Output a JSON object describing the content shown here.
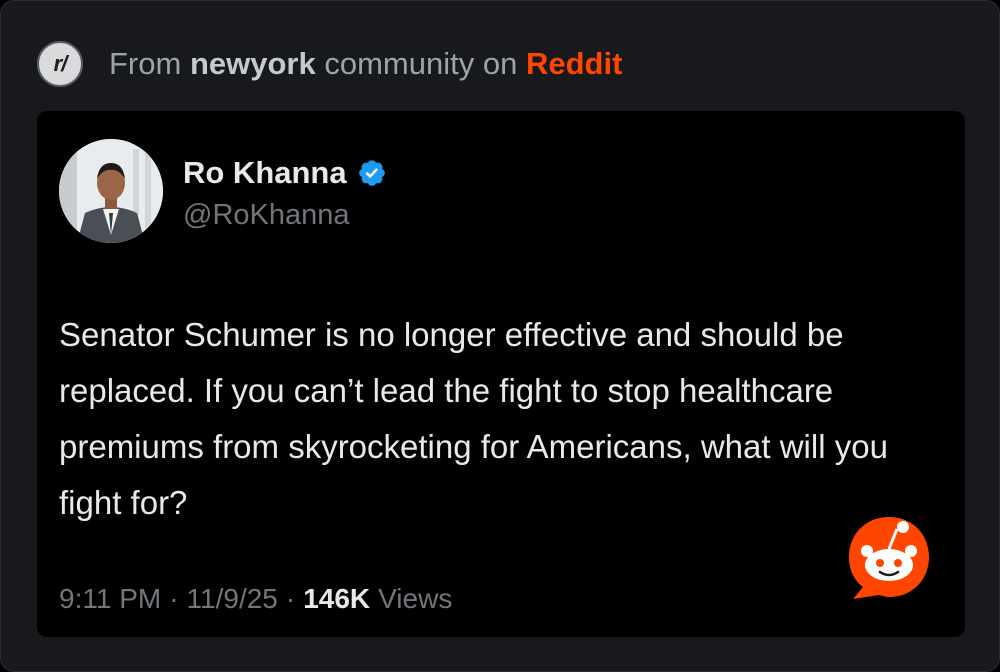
{
  "source": {
    "icon_text": "r/",
    "prefix": "From",
    "community": "newyork",
    "middle": "community on",
    "platform": "Reddit"
  },
  "tweet": {
    "author_name": "Ro Khanna",
    "handle": "@RoKhanna",
    "text": "Senator Schumer is no longer effective and should be replaced. If you can’t lead the fight to stop healthcare premiums from skyrocketing for Americans, what will you fight for?",
    "time": "9:11 PM",
    "date": "11/9/25",
    "views_count": "146K",
    "views_label": "Views",
    "separator": "·"
  },
  "colors": {
    "reddit_orange": "#ff4500",
    "verified_blue": "#1d9bf0"
  }
}
